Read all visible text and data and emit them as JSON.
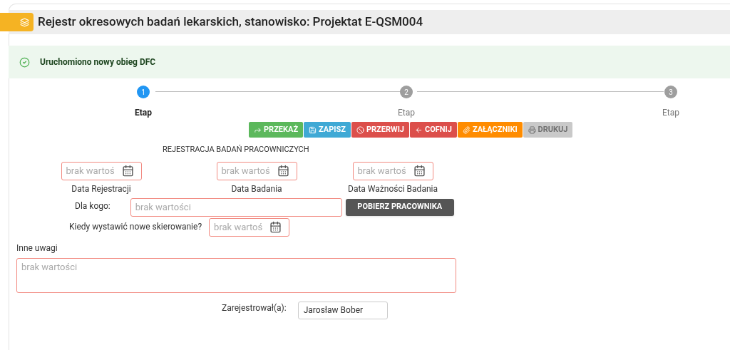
{
  "header": {
    "title": "Rejestr okresowych badań lekarskich, stanowisko: Projektat E-QSM004"
  },
  "alert": {
    "message": "Uruchomiono nowy obieg DFC"
  },
  "steps": [
    {
      "number": "1",
      "label": "Etap",
      "selected": true
    },
    {
      "number": "2",
      "label": "Etap",
      "selected": false
    },
    {
      "number": "3",
      "label": "Etap",
      "selected": false
    }
  ],
  "actions": [
    {
      "label": "PRZEKAŻ",
      "color": "#5cb85c",
      "disabled": false
    },
    {
      "label": "ZAPISZ",
      "color": "#3fa9d5",
      "disabled": false
    },
    {
      "label": "PRZERWIJ",
      "color": "#dc4f4b",
      "disabled": false
    },
    {
      "label": "COFNIJ",
      "color": "#dc4f4b",
      "disabled": false
    },
    {
      "label": "ZAŁĄCZNIKI",
      "color": "#ff8c00",
      "disabled": false
    },
    {
      "label": "DRUKUJ",
      "color": "#c9c9c9",
      "disabled": true
    }
  ],
  "form": {
    "section_title": "REJESTRACJA BADAŃ PRACOWNICZYCH",
    "dates": [
      {
        "label": "Data Rejestracji",
        "placeholder": "brak wartoś"
      },
      {
        "label": "Data Badania",
        "placeholder": "brak wartoś"
      },
      {
        "label": "Data Ważności Badania",
        "placeholder": "brak wartoś"
      }
    ],
    "for_whom": {
      "label": "Dla kogo:",
      "placeholder": "brak wartości",
      "button": "POBIERZ PRACOWNIKA"
    },
    "next_referral": {
      "label": "Kiedy wystawić nowe skierowanie?",
      "placeholder": "brak wartoś"
    },
    "notes": {
      "label": "Inne uwagi",
      "placeholder": "brak wartości"
    },
    "registered_by": {
      "label": "Zarejestrował(a):",
      "value": "Jarosław Bober"
    }
  }
}
